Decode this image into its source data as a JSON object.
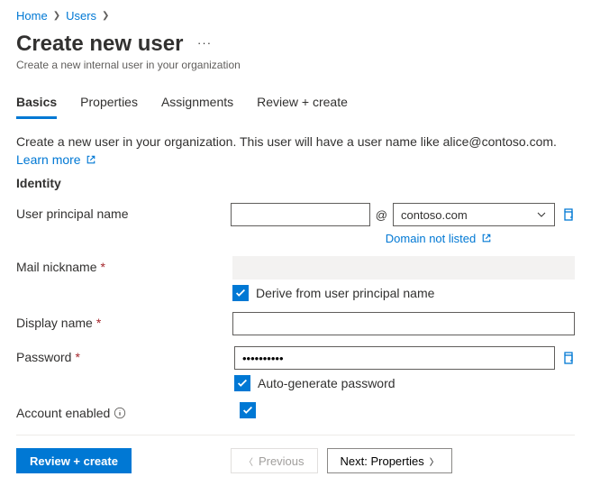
{
  "breadcrumb": {
    "home": "Home",
    "users": "Users"
  },
  "page": {
    "title": "Create new user",
    "subtitle": "Create a new internal user in your organization",
    "description": "Create a new user in your organization. This user will have a user name like alice@contoso.com.",
    "learn_more": "Learn more"
  },
  "tabs": {
    "basics": "Basics",
    "properties": "Properties",
    "assignments": "Assignments",
    "review": "Review + create"
  },
  "identity": {
    "heading": "Identity",
    "upn_label": "User principal name",
    "upn_value": "",
    "at": "@",
    "domain_selected": "contoso.com",
    "domain_not_listed": "Domain not listed",
    "mail_label": "Mail nickname",
    "mail_value": "",
    "derive_label": "Derive from user principal name",
    "derive_checked": true,
    "display_label": "Display name",
    "display_value": "",
    "password_label": "Password",
    "password_value": "••••••••••",
    "autogen_label": "Auto-generate password",
    "autogen_checked": true,
    "account_label": "Account enabled",
    "account_checked": true
  },
  "footer": {
    "review": "Review + create",
    "previous": "Previous",
    "next": "Next: Properties"
  }
}
